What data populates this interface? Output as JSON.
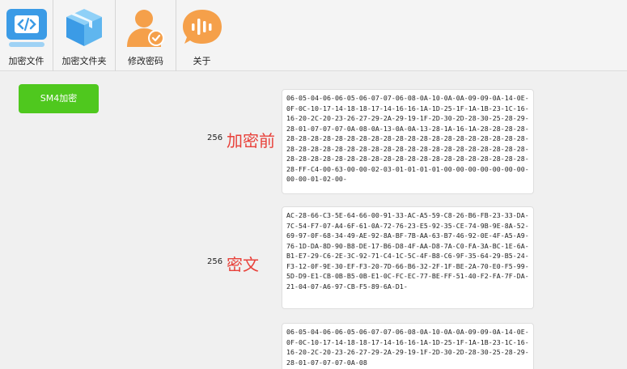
{
  "toolbar": {
    "items": [
      {
        "label": "加密文件",
        "icon": "code-file-icon"
      },
      {
        "label": "加密文件夹",
        "icon": "box-folder-icon"
      },
      {
        "label": "修改密码",
        "icon": "user-check-icon"
      },
      {
        "label": "关于",
        "icon": "voice-bubble-icon"
      }
    ]
  },
  "encrypt_button": {
    "label": "SM4加密"
  },
  "sections": {
    "before": {
      "count": "256",
      "label": "加密前",
      "text": "06-05-04-06-06-05-06-07-07-06-08-0A-10-0A-0A-09-09-0A-14-0E-0F-0C-10-17-14-18-18-17-14-16-16-1A-1D-25-1F-1A-1B-23-1C-16-16-20-2C-20-23-26-27-29-2A-29-19-1F-2D-30-2D-28-30-25-28-29-28-01-07-07-07-0A-08-0A-13-0A-0A-13-28-1A-16-1A-28-28-28-28-28-28-28-28-28-28-28-28-28-28-28-28-28-28-28-28-28-28-28-28-28-28-28-28-28-28-28-28-28-28-28-28-28-28-28-28-28-28-28-28-28-28-28-28-28-28-28-28-28-28-28-28-28-28-28-28-28-28-28-28-28-FF-C4-00-63-00-00-02-03-01-01-01-01-00-00-00-00-00-00-00-00-00-01-02-00-"
    },
    "cipher": {
      "count": "256",
      "label": "密文",
      "text": "AC-28-66-C3-5E-64-66-00-91-33-AC-A5-59-C8-26-B6-FB-23-33-DA-7C-54-F7-07-A4-6F-61-0A-72-76-23-E5-92-35-CE-74-9B-9E-8A-52-69-97-0F-68-34-49-AE-92-8A-BF-7B-AA-63-B7-46-92-0E-4F-A5-A9-76-1D-DA-8D-90-B8-DE-17-B6-D8-4F-AA-D8-7A-C0-FA-3A-BC-1E-6A-B1-E7-29-C6-2E-3C-92-71-C4-1C-5C-4F-B8-C6-9F-35-64-29-B5-24-F3-12-0F-9E-30-EF-F3-20-7D-66-B6-32-2F-1F-BE-2A-70-E0-F5-99-5D-D9-E1-CB-0B-B5-0B-E1-0C-FC-EC-77-BE-FF-51-40-F2-FA-7F-DA-21-04-07-A6-97-CB-F5-89-6A-D1-"
    },
    "after": {
      "text": "06-05-04-06-06-05-06-07-07-06-08-0A-10-0A-0A-09-09-0A-14-0E-0F-0C-10-17-14-18-18-17-14-16-16-1A-1D-25-1F-1A-1B-23-1C-16-16-20-2C-20-23-26-27-29-2A-29-19-1F-2D-30-2D-28-30-25-28-29-28-01-07-07-07-0A-08"
    }
  },
  "colors": {
    "button_green": "#4fc81e",
    "label_red": "#e8413a",
    "icon_blue": "#3b9be6",
    "icon_orange": "#f5a04a"
  }
}
